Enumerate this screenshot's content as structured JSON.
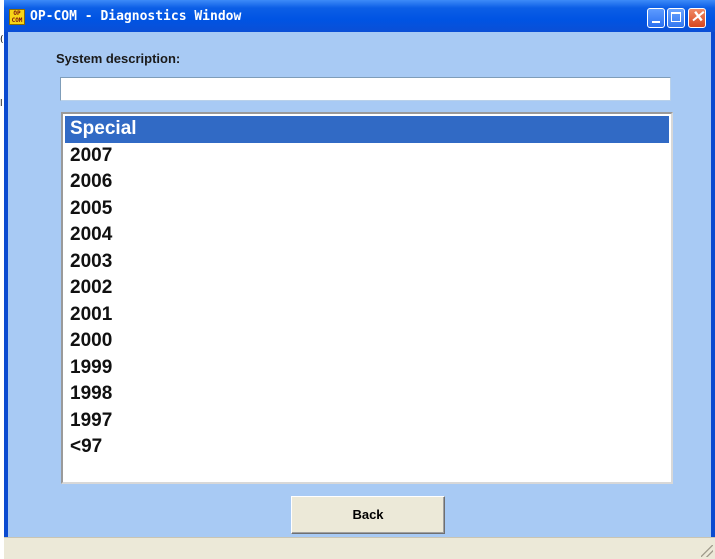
{
  "window": {
    "title": "OP-COM - Diagnostics Window",
    "icon_text": "OP COM"
  },
  "form": {
    "system_label": "System description:",
    "system_value": ""
  },
  "list": {
    "items": [
      {
        "label": "Special",
        "selected": true
      },
      {
        "label": "2007"
      },
      {
        "label": "2006"
      },
      {
        "label": "2005"
      },
      {
        "label": "2004"
      },
      {
        "label": "2003"
      },
      {
        "label": "2002"
      },
      {
        "label": "2001"
      },
      {
        "label": "2000"
      },
      {
        "label": "1999"
      },
      {
        "label": "1998"
      },
      {
        "label": "1997"
      },
      {
        "label": "<97"
      }
    ]
  },
  "buttons": {
    "back_label": "Back"
  },
  "colors": {
    "titlebar": "#0054e3",
    "client_bg": "#a8caf4",
    "selection": "#316ac5"
  },
  "icons": {
    "app": "op-com-app-icon",
    "minimize": "minimize-icon",
    "maximize": "maximize-icon",
    "close": "close-icon"
  }
}
